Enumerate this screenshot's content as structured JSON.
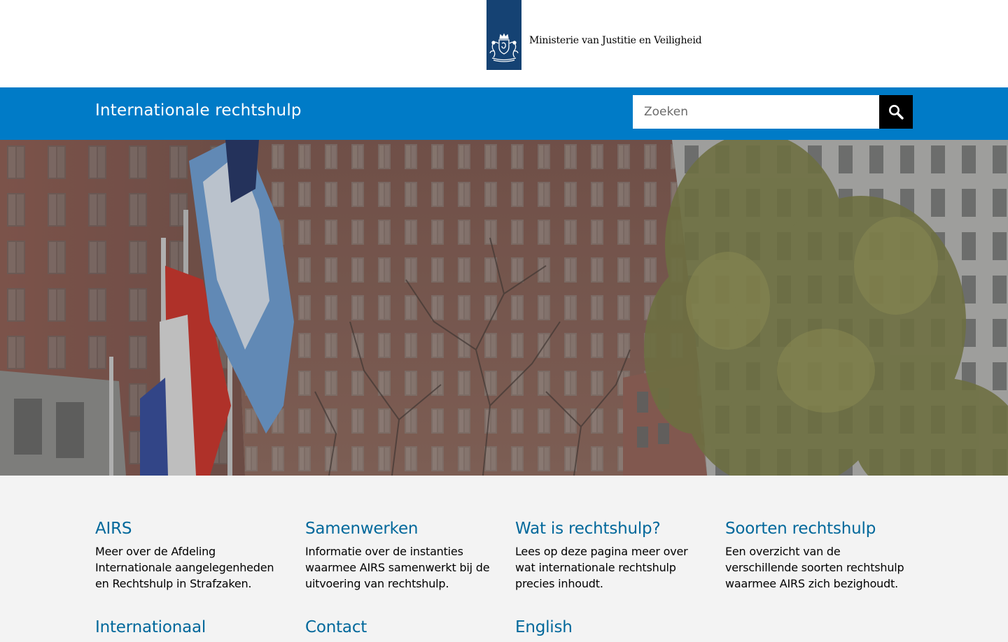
{
  "branding": {
    "ministry_name": "Ministerie van Justitie en Veiligheid",
    "brand_color": "#154273",
    "logo_icon": "coat-of-arms-icon"
  },
  "header": {
    "site_title": "Internationale rechtshulp",
    "search": {
      "placeholder": "Zoeken",
      "value": "",
      "button_icon": "search-icon"
    },
    "bar_color": "#007bc7"
  },
  "hero": {
    "image_description": ""
  },
  "tiles": [
    {
      "title": "AIRS",
      "description": "Meer over de Afdeling Internationale aangelegenheden en Rechtshulp in Strafzaken."
    },
    {
      "title": "Samenwerken",
      "description": "Informatie over de instanties waarmee AIRS samenwerkt bij de uitvoering van rechtshulp."
    },
    {
      "title": "Wat is rechtshulp?",
      "description": "Lees op deze pagina meer over wat internationale rechtshulp precies inhoudt."
    },
    {
      "title": "Soorten rechtshulp",
      "description": "Een overzicht van de verschillende soorten rechtshulp waarmee AIRS zich bezighoudt."
    },
    {
      "title": "Internationaal",
      "description": ""
    },
    {
      "title": "Contact",
      "description": ""
    },
    {
      "title": "English",
      "description": ""
    }
  ],
  "colors": {
    "link": "#01689b",
    "page_background": "#f3f3f3"
  }
}
